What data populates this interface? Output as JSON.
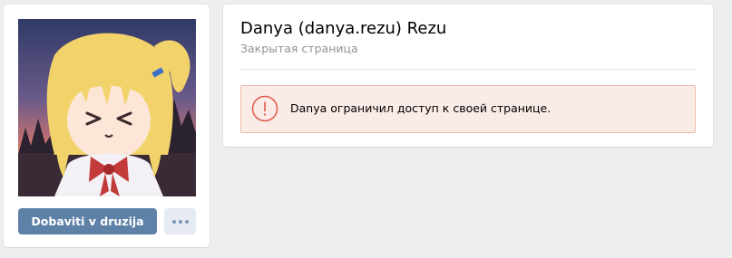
{
  "profile": {
    "name": "Danya (danya.rezu) Rezu",
    "status": "Закрытая страница",
    "restriction_message": "Danya ограничил доступ к своей странице."
  },
  "actions": {
    "add_friend_label": "Dobaviti v druzija",
    "more_icon": "more-horizontal-dots"
  },
  "icons": {
    "warning": "exclamation-circle",
    "avatar": "anime-girl-avatar"
  },
  "colors": {
    "page_background": "#edeef0",
    "button_primary": "#5e81a8",
    "warning_background": "#faebe7",
    "warning_border": "#f1b8a8",
    "warning_icon": "#e05a49"
  }
}
